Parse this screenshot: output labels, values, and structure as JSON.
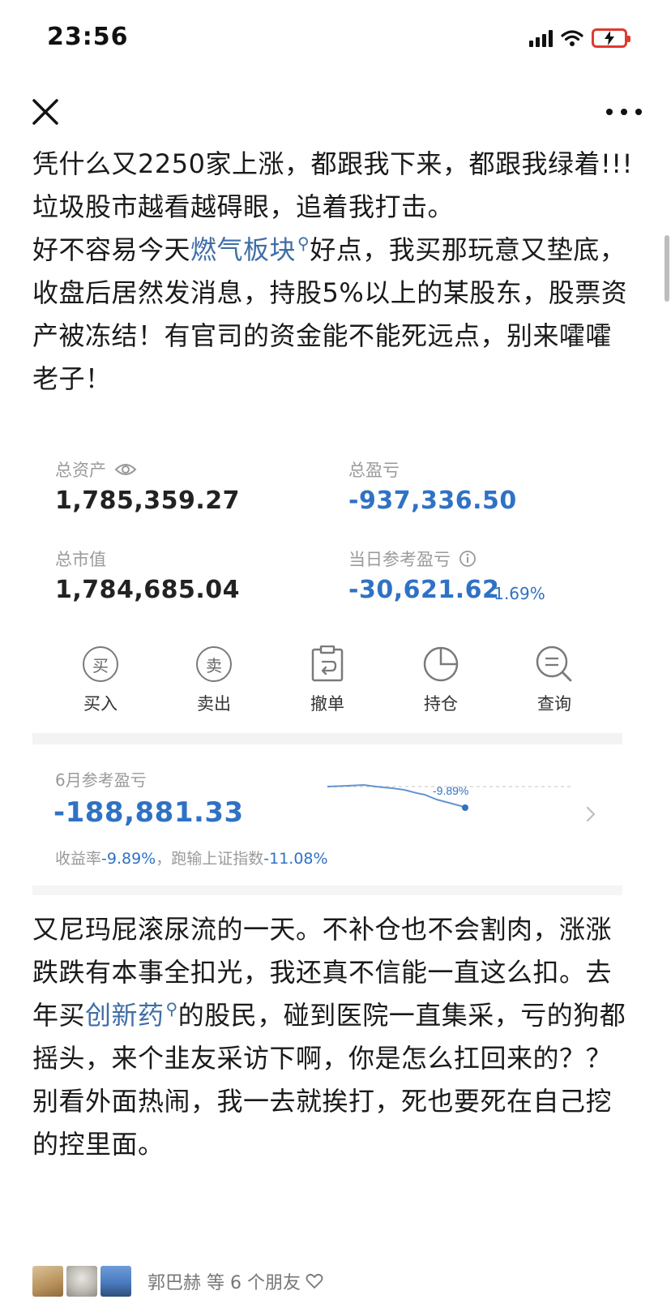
{
  "status_bar": {
    "time": "23:56"
  },
  "nav": {
    "close_icon": "close-icon",
    "more_icon": "more-icon"
  },
  "post": {
    "paragraph1": {
      "line1": "凭什么又2250家上涨，都跟我下来，都跟我绿着!!!",
      "line2": "垃圾股市越看越碍眼，追着我打击。",
      "line3_before": "好不容易今天",
      "line3_topic": "燃气板块",
      "line3_after": "好点，我买那玩意又垫底，收盘后居然发消息，持股5%以上的某股东，股票资产被冻结！有官司的资金能不能死远点，别来嚯嚯老子！"
    },
    "paragraph2": {
      "line1_before": "又尼玛屁滚尿流的一天。不补仓也不会割肉，涨涨跌跌有本事全扣光，我还真不信能一直这么扣。去年买",
      "line1_topic": "创新药",
      "line1_after": "的股民，碰到医院一直集采，亏的狗都摇头，来个韭友采访下啊，你是怎么扛回来的？？",
      "line2": "别看外面热闹，我一去就挨打，死也要死在自己挖的控里面。"
    }
  },
  "account": {
    "total_assets_label": "总资产",
    "total_assets_value": "1,785,359.27",
    "total_pnl_label": "总盈亏",
    "total_pnl_value": "-937,336.50",
    "market_value_label": "总市值",
    "market_value_value": "1,784,685.04",
    "daily_pnl_label": "当日参考盈亏",
    "daily_pnl_value": "-30,621.62",
    "daily_pnl_pct": "-1.69%"
  },
  "actions": [
    {
      "label": "买入",
      "glyph": "买"
    },
    {
      "label": "卖出",
      "glyph": "卖"
    },
    {
      "label": "撤单"
    },
    {
      "label": "持仓"
    },
    {
      "label": "查询"
    }
  ],
  "monthly": {
    "label": "6月参考盈亏",
    "value": "-188,881.33",
    "sub_prefix": "收益率",
    "sub_rate": "-9.89%",
    "sub_mid": "，跑输上证指数",
    "sub_index": "-11.08%",
    "spark_label": "-9.89%"
  },
  "likes": {
    "text": "郭巴赫 等 6 个朋友"
  },
  "colors": {
    "accent_blue": "#2f72c4",
    "topic_blue": "#3f6ea6",
    "battery_red": "#e03a2f"
  }
}
